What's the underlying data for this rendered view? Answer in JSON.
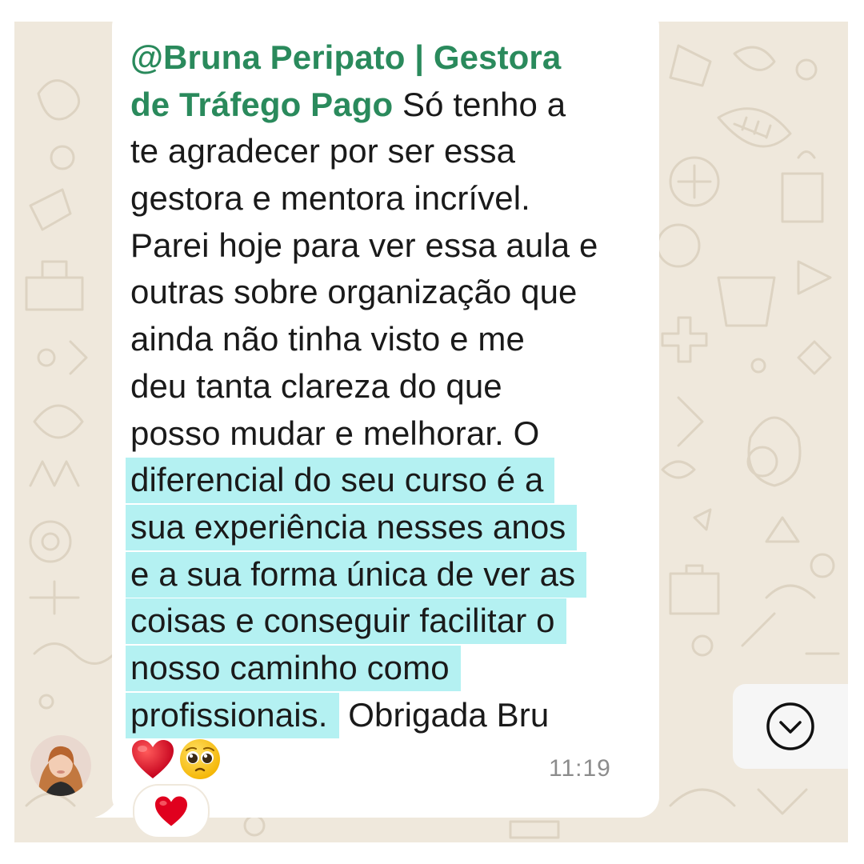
{
  "chat": {
    "mention": "@Bruna Peripato | Gestora de Tráfego Pago",
    "message_lines": [
      {
        "parts": [
          {
            "text": "@Bruna Peripato | Gestora",
            "style": "mention"
          }
        ]
      },
      {
        "parts": [
          {
            "text": "de Tráfego Pago",
            "style": "mention"
          },
          {
            "text": " Só tenho a",
            "style": "plain"
          }
        ]
      },
      {
        "parts": [
          {
            "text": "te agradecer por ser essa",
            "style": "plain"
          }
        ]
      },
      {
        "parts": [
          {
            "text": "gestora e mentora incrível.",
            "style": "plain"
          }
        ]
      },
      {
        "parts": [
          {
            "text": "Parei hoje para ver essa aula e",
            "style": "plain"
          }
        ]
      },
      {
        "parts": [
          {
            "text": "outras sobre organização que",
            "style": "plain"
          }
        ]
      },
      {
        "parts": [
          {
            "text": "ainda não tinha visto e me",
            "style": "plain"
          }
        ]
      },
      {
        "parts": [
          {
            "text": "deu tanta clareza do que",
            "style": "plain"
          }
        ]
      },
      {
        "parts": [
          {
            "text": "posso mudar e melhorar. O",
            "style": "plain"
          }
        ]
      },
      {
        "parts": [
          {
            "text": "diferencial do seu curso é a",
            "style": "highlight"
          }
        ]
      },
      {
        "parts": [
          {
            "text": "sua experiência nesses anos",
            "style": "highlight"
          }
        ]
      },
      {
        "parts": [
          {
            "text": "e a sua forma única de ver as",
            "style": "highlight"
          }
        ]
      },
      {
        "parts": [
          {
            "text": "coisas e conseguir facilitar o",
            "style": "highlight"
          }
        ]
      },
      {
        "parts": [
          {
            "text": "nosso caminho como",
            "style": "highlight"
          }
        ]
      },
      {
        "parts": [
          {
            "text": "profissionais.",
            "style": "highlight"
          },
          {
            "text": " Obrigada Bru",
            "style": "plain"
          }
        ]
      }
    ],
    "emojis": [
      "red-heart",
      "pleading-face"
    ],
    "timestamp": "11:19",
    "reaction": "red-heart",
    "scroll_button_icon": "chevron-down-circle-icon",
    "colors": {
      "mention": "#2a8a5c",
      "highlight": "#b4f1f2",
      "wallpaper": "#efe8dc",
      "bubble": "#ffffff",
      "timestamp": "#8c8c8c"
    }
  }
}
